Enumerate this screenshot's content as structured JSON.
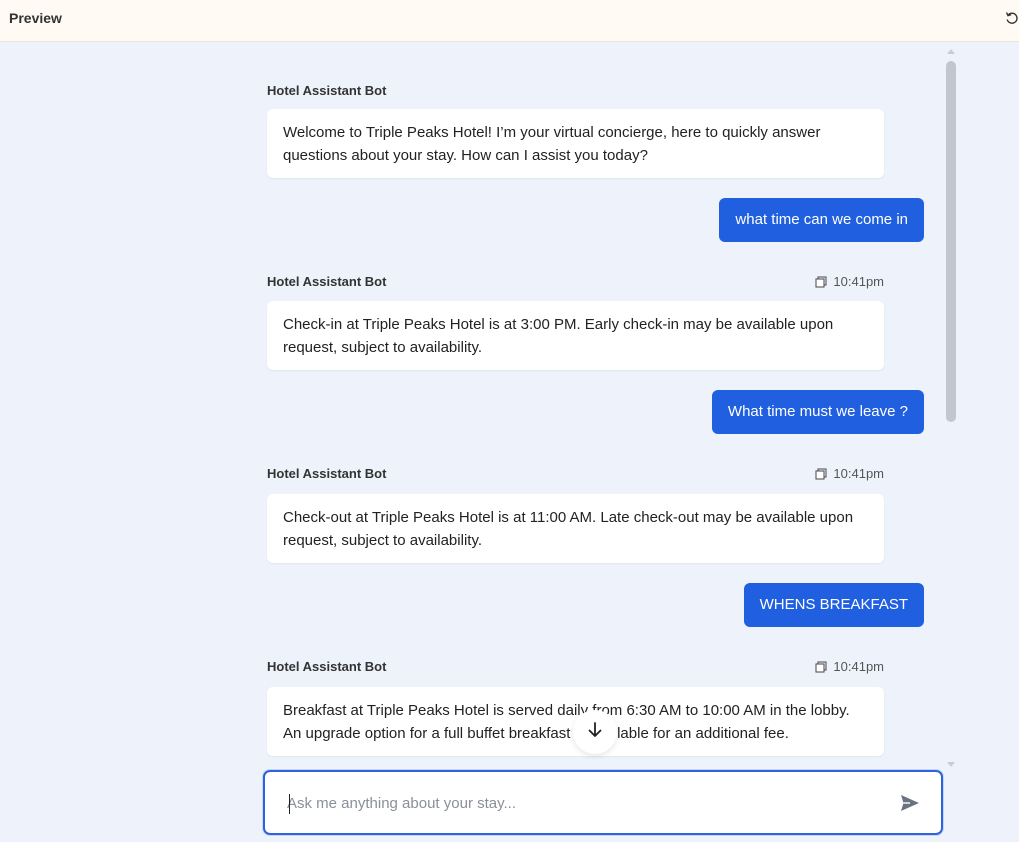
{
  "header": {
    "title": "Preview",
    "refresh_icon": "refresh-icon"
  },
  "messages": [
    {
      "role": "bot",
      "sender": "Hotel Assistant Bot",
      "time": "",
      "text": "Welcome to Triple Peaks Hotel! I’m your virtual concierge, here to quickly answer questions about your stay. How can I assist you today?"
    },
    {
      "role": "user",
      "text": "what time can we come in"
    },
    {
      "role": "bot",
      "sender": "Hotel Assistant Bot",
      "time": "10:41pm",
      "text": "Check-in at Triple Peaks Hotel is at 3:00 PM. Early check-in may be available upon request, subject to availability."
    },
    {
      "role": "user",
      "text": "What time must we leave ?"
    },
    {
      "role": "bot",
      "sender": "Hotel Assistant Bot",
      "time": "10:41pm",
      "text": "Check-out at Triple Peaks Hotel is at 11:00 AM. Late check-out may be available upon request, subject to availability."
    },
    {
      "role": "user",
      "text": "WHENS BREAKFAST"
    },
    {
      "role": "bot",
      "sender": "Hotel Assistant Bot",
      "time": "10:41pm",
      "text": "Breakfast at Triple Peaks Hotel is served daily from 6:30 AM to 10:00 AM in the lobby. An upgrade option for a full buffet breakfast is available for an additional fee."
    }
  ],
  "composer": {
    "placeholder": "Ask me anything about your stay...",
    "value": "",
    "send_icon": "send-icon"
  },
  "colors": {
    "accent": "#1f5fe0",
    "background": "#eef3fb",
    "header_bg": "#fffaf3"
  }
}
